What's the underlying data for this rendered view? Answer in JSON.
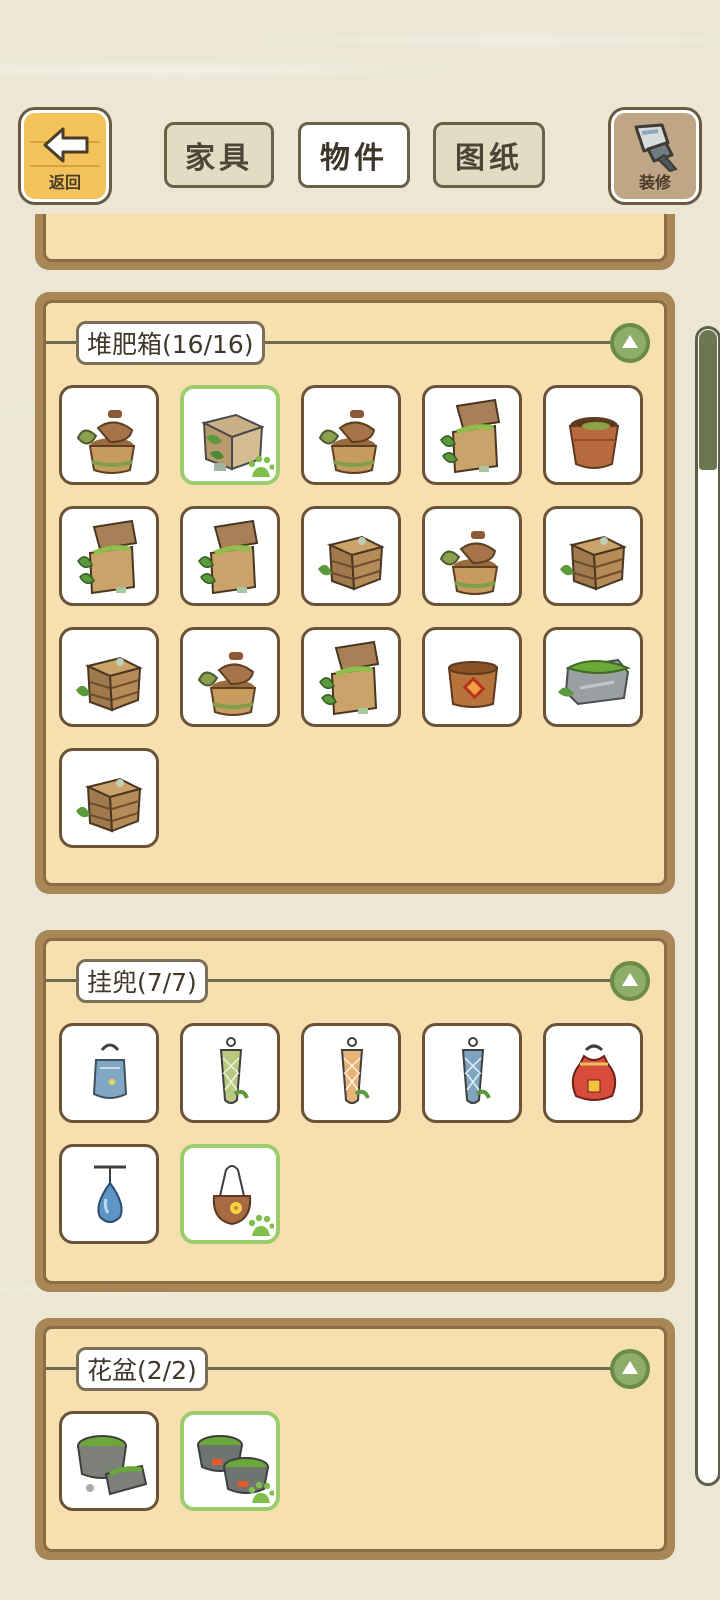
{
  "header": {
    "back_label": "返回",
    "decorate_label": "装修",
    "tabs": [
      {
        "label": "家具",
        "active": false
      },
      {
        "label": "物件",
        "active": true
      },
      {
        "label": "图纸",
        "active": false
      }
    ]
  },
  "sections": [
    {
      "title": "堆肥箱(16/16)",
      "items": [
        {
          "icon": "compost-bucket-leaf-icon"
        },
        {
          "icon": "compost-crate-metal-icon",
          "selected": true
        },
        {
          "icon": "compost-bucket-leaf-icon"
        },
        {
          "icon": "compost-box-lid-open-icon"
        },
        {
          "icon": "compost-bucket-open-icon"
        },
        {
          "icon": "compost-box-lid-open-icon"
        },
        {
          "icon": "compost-box-lid-open-icon"
        },
        {
          "icon": "compost-wood-crate-icon"
        },
        {
          "icon": "compost-bucket-leaf-icon"
        },
        {
          "icon": "compost-wood-crate-icon"
        },
        {
          "icon": "compost-wood-crate-icon"
        },
        {
          "icon": "compost-bucket-leaf-icon"
        },
        {
          "icon": "compost-box-lid-open-icon"
        },
        {
          "icon": "compost-pot-orange-icon"
        },
        {
          "icon": "compost-stone-bin-icon"
        },
        {
          "icon": "compost-wood-crate-icon"
        }
      ]
    },
    {
      "title": "挂兜(7/7)",
      "items": [
        {
          "icon": "hanging-pouch-blue-icon"
        },
        {
          "icon": "hanging-net-green-icon"
        },
        {
          "icon": "hanging-net-tan-icon"
        },
        {
          "icon": "hanging-net-blue-icon"
        },
        {
          "icon": "hanging-sack-red-icon"
        },
        {
          "icon": "hanging-drop-blue-icon"
        },
        {
          "icon": "hanging-pouch-flower-icon",
          "selected": true
        }
      ]
    },
    {
      "title": "花盆(2/2)",
      "items": [
        {
          "icon": "flower-pot-moss-broken-icon"
        },
        {
          "icon": "flower-pot-moss-pair-icon",
          "selected": true
        }
      ]
    }
  ]
}
